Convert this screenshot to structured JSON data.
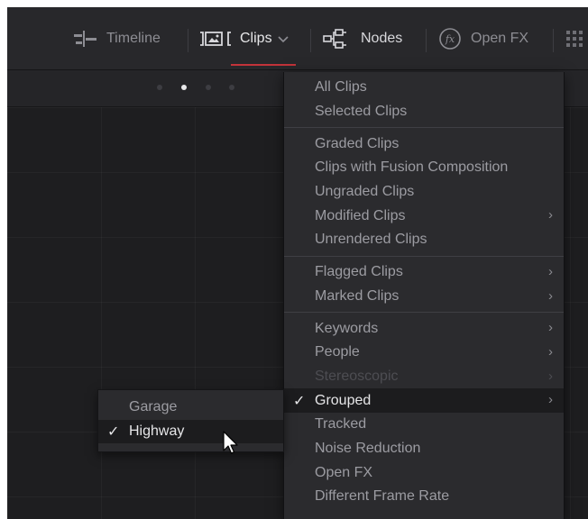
{
  "toolbar": {
    "timeline": {
      "icon": "timeline-icon",
      "label": "Timeline"
    },
    "clips": {
      "icon": "clips-filmstrip-icon",
      "label": "Clips",
      "dropdown_icon": "chevron-down-icon"
    },
    "nodes": {
      "icon": "nodes-icon",
      "label": "Nodes"
    },
    "openfx": {
      "icon": "fx-icon",
      "label": "Open FX"
    },
    "more": {
      "icon": "grid-icon"
    }
  },
  "page_strip": {
    "dots": 4,
    "active_index": 1
  },
  "clips_menu": {
    "groups": [
      {
        "items": [
          {
            "label": "All Clips"
          },
          {
            "label": "Selected Clips"
          }
        ]
      },
      {
        "items": [
          {
            "label": "Graded Clips"
          },
          {
            "label": "Clips with Fusion Composition"
          },
          {
            "label": "Ungraded Clips"
          },
          {
            "label": "Modified Clips",
            "submenu": true
          },
          {
            "label": "Unrendered Clips"
          }
        ]
      },
      {
        "items": [
          {
            "label": "Flagged Clips",
            "submenu": true
          },
          {
            "label": "Marked Clips",
            "submenu": true
          }
        ]
      },
      {
        "items": [
          {
            "label": "Keywords",
            "submenu": true
          },
          {
            "label": "People",
            "submenu": true
          },
          {
            "label": "Stereoscopic",
            "submenu": true,
            "disabled": true
          },
          {
            "label": "Grouped",
            "submenu": true,
            "checked": true,
            "active": true
          },
          {
            "label": "Tracked"
          },
          {
            "label": "Noise Reduction"
          },
          {
            "label": "Open FX"
          },
          {
            "label": "Different Frame Rate"
          }
        ]
      }
    ],
    "check_glyph": "✓",
    "chevron_glyph": "›"
  },
  "grouped_submenu": {
    "items": [
      {
        "label": "Garage"
      },
      {
        "label": "Highway",
        "checked": true
      }
    ]
  },
  "colors": {
    "accent_underline": "#c2333a",
    "menu_bg": "#2b2b2e",
    "toolbar_bg": "#28282b"
  }
}
